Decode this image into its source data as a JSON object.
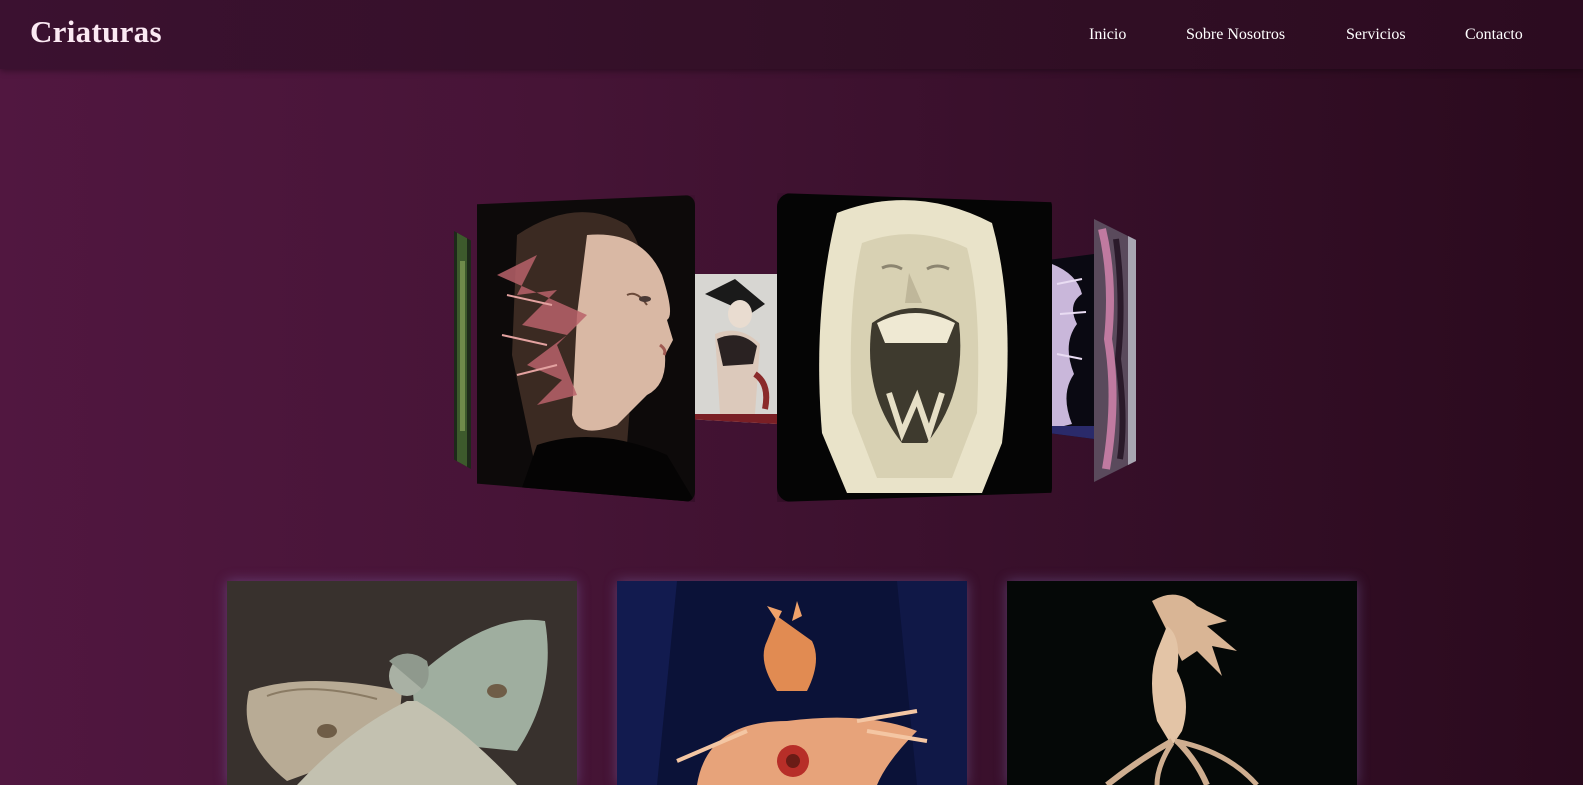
{
  "header": {
    "brand": "Criaturas",
    "nav": [
      {
        "label": "Inicio"
      },
      {
        "label": "Sobre Nosotros"
      },
      {
        "label": "Servicios"
      },
      {
        "label": "Contacto"
      }
    ]
  },
  "colors": {
    "background_left": "#511740",
    "background_right": "#2a0a1d",
    "navbar": "#331027",
    "brand_text": "#fbe9f3",
    "nav_text": "#ffffff"
  },
  "carousel": {
    "items": [
      {
        "subject": "green sculpture (far left, edge view)"
      },
      {
        "subject": "pale woman profile with coral-like ear"
      },
      {
        "subject": "dark figure sculpture"
      },
      {
        "subject": "screaming white veiled face sculpture"
      },
      {
        "subject": "lavender creature sculpture"
      },
      {
        "subject": "pink tendril creature (far right, edge view)"
      }
    ]
  },
  "gallery": {
    "items": [
      {
        "subject": "winged fairy statue"
      },
      {
        "subject": "feathered flame creature"
      },
      {
        "subject": "pale mermaid creature"
      }
    ]
  }
}
